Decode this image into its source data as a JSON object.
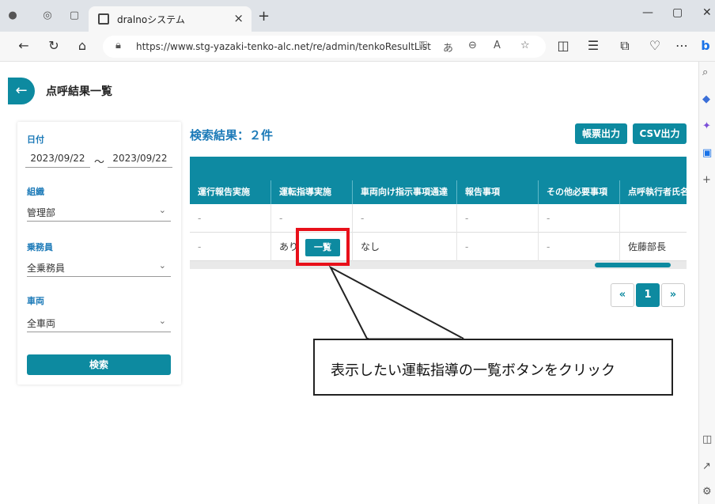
{
  "browser": {
    "tab_title": "dralnoシステム",
    "url": "https://www.stg-yazaki-tenko-alc.net/re/admin/tenkoResultList"
  },
  "page": {
    "title": "点呼結果一覧"
  },
  "filters": {
    "date_label": "日付",
    "date_from": "2023/09/22",
    "date_sep": "～",
    "date_to": "2023/09/22",
    "org_label": "組織",
    "org_value": "管理部",
    "crew_label": "乗務員",
    "crew_value": "全乗務員",
    "vehicle_label": "車両",
    "vehicle_value": "全車両",
    "search_label": "検索"
  },
  "results": {
    "count_text": "検索結果：２件",
    "report_btn": "帳票出力",
    "csv_btn": "CSV出力",
    "columns": [
      "運行報告実施",
      "運転指導実施",
      "車両向け指示事項通達",
      "報告事項",
      "その他必要事項",
      "点呼執行者氏名"
    ],
    "rows": [
      [
        "-",
        "-",
        "-",
        "-",
        "-",
        ""
      ],
      [
        "-",
        "あり",
        "なし",
        "-",
        "-",
        "佐藤部長"
      ]
    ],
    "list_btn": "一覧"
  },
  "pager": {
    "prev": "«",
    "current": "1",
    "next": "»"
  },
  "annotation": {
    "text": "表示したい運転指導の一覧ボタンをクリック"
  },
  "colors": {
    "accent": "#0d8aa0",
    "label_blue": "#1c7ab8",
    "highlight_red": "#e8101a"
  }
}
